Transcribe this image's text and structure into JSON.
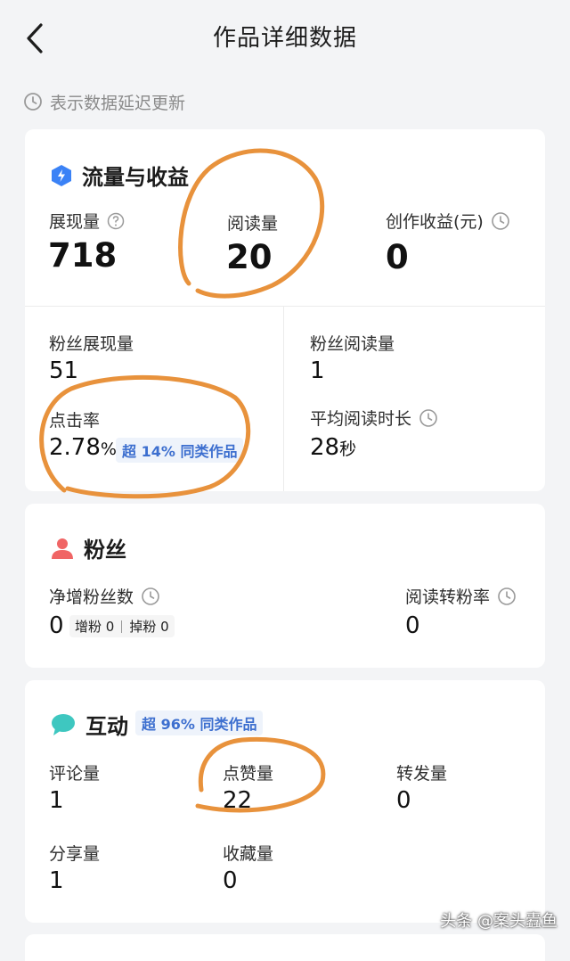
{
  "header": {
    "title": "作品详细数据"
  },
  "notice": "表示数据延迟更新",
  "traffic": {
    "title": "流量与收益",
    "impressions_label": "展现量",
    "impressions_value": "718",
    "reads_label": "阅读量",
    "reads_value": "20",
    "income_label": "创作收益(元)",
    "income_value": "0",
    "fan_impressions_label": "粉丝展现量",
    "fan_impressions_value": "51",
    "fan_reads_label": "粉丝阅读量",
    "fan_reads_value": "1",
    "ctr_label": "点击率",
    "ctr_value": "2.78",
    "ctr_unit": "%",
    "ctr_badge": "超 14% 同类作品",
    "avg_time_label": "平均阅读时长",
    "avg_time_value": "28",
    "avg_time_unit": "秒"
  },
  "fans": {
    "title": "粉丝",
    "net_label": "净增粉丝数",
    "net_value": "0",
    "gain_label": "增粉",
    "gain_value": "0",
    "lost_label": "掉粉",
    "lost_value": "0",
    "conv_label": "阅读转粉率",
    "conv_value": "0"
  },
  "interaction": {
    "title": "互动",
    "badge": "超 96% 同类作品",
    "comments_label": "评论量",
    "comments_value": "1",
    "likes_label": "点赞量",
    "likes_value": "22",
    "reposts_label": "转发量",
    "reposts_value": "0",
    "shares_label": "分享量",
    "shares_value": "1",
    "favorites_label": "收藏量",
    "favorites_value": "0"
  },
  "watermark": "头条 @案头蠹鱼",
  "colors": {
    "annotation": "#e8923c",
    "accent_blue": "#3d6fcf",
    "fan_icon": "#f06565",
    "chat_icon": "#3ec7c0",
    "bolt_icon": "#3b82f6"
  }
}
